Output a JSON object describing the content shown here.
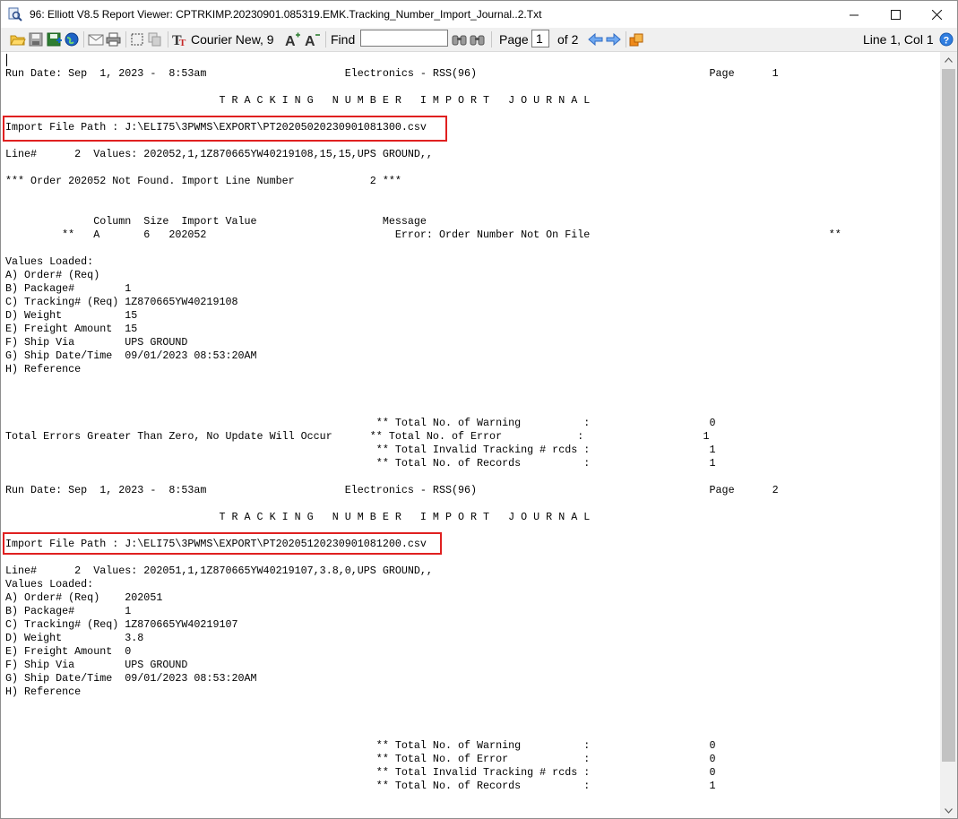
{
  "window": {
    "title": "96: Elliott V8.5 Report Viewer: CPTRKIMP.20230901.085319.EMK.Tracking_Number_Import_Journal..2.Txt",
    "minimize_icon": "minimize-icon",
    "maximize_icon": "maximize-icon",
    "close_icon": "close-icon"
  },
  "toolbar": {
    "icons": [
      "open-folder-icon",
      "save-icon",
      "save-as-icon",
      "globe-icon",
      "email-icon",
      "print-icon",
      "select-all-icon",
      "copy-icon",
      "font-icon",
      "increase-font-icon",
      "decrease-font-icon",
      "find-next-icon",
      "find-prev-icon",
      "prev-page-icon",
      "next-page-icon",
      "export-icon",
      "help-icon"
    ],
    "font_label": "Courier New, 9",
    "find_label": "Find",
    "find_value": "",
    "page_label": "Page",
    "page_value": "1",
    "page_of": "of 2",
    "position": "Line 1, Col 1"
  },
  "report": {
    "lines": [
      {
        "text": "Run Date: Sep  1, 2023 -  8:53am                      Electronics - RSS(96)                                     Page      1"
      },
      {
        "text": "                                  T R A C K I N G   N U M B E R   I M P O R T   J O U R N A L"
      },
      {
        "text": "Import File Path : J:\\ELI75\\3PWMS\\EXPORT\\PT20205020230901081300.csv"
      },
      {
        "text": "Line#      2  Values: 202052,1,1Z870665YW40219108,15,15,UPS GROUND,,"
      },
      {
        "text": "*** Order 202052 Not Found. Import Line Number            2 ***"
      },
      {
        "text": "              Column  Size  Import Value                    Message"
      },
      {
        "text": "         **   A       6   202052                              Error: Order Number Not On File                                      **"
      },
      {
        "text": "Values Loaded:"
      },
      {
        "text": "A) Order# (Req)"
      },
      {
        "text": "B) Package#        1"
      },
      {
        "text": "C) Tracking# (Req) 1Z870665YW40219108"
      },
      {
        "text": "D) Weight          15"
      },
      {
        "text": "E) Freight Amount  15"
      },
      {
        "text": "F) Ship Via        UPS GROUND"
      },
      {
        "text": "G) Ship Date/Time  09/01/2023 08:53:20AM"
      },
      {
        "text": "H) Reference"
      },
      {
        "text": "                                                           ** Total No. of Warning          :                   0"
      },
      {
        "text": "Total Errors Greater Than Zero, No Update Will Occur      ** Total No. of Error            :                   1"
      },
      {
        "text": "                                                           ** Total Invalid Tracking # rcds :                   1"
      },
      {
        "text": "                                                           ** Total No. of Records          :                   1"
      },
      {
        "text": "Run Date: Sep  1, 2023 -  8:53am                      Electronics - RSS(96)                                     Page      2"
      },
      {
        "text": "                                  T R A C K I N G   N U M B E R   I M P O R T   J O U R N A L"
      },
      {
        "text": "Import File Path : J:\\ELI75\\3PWMS\\EXPORT\\PT20205120230901081200.csv"
      },
      {
        "text": "Line#      2  Values: 202051,1,1Z870665YW40219107,3.8,0,UPS GROUND,,"
      },
      {
        "text": "Values Loaded:"
      },
      {
        "text": "A) Order# (Req)    202051"
      },
      {
        "text": "B) Package#        1"
      },
      {
        "text": "C) Tracking# (Req) 1Z870665YW40219107"
      },
      {
        "text": "D) Weight          3.8"
      },
      {
        "text": "E) Freight Amount  0"
      },
      {
        "text": "F) Ship Via        UPS GROUND"
      },
      {
        "text": "G) Ship Date/Time  09/01/2023 08:53:20AM"
      },
      {
        "text": "H) Reference"
      },
      {
        "text": "                                                           ** Total No. of Warning          :                   0"
      },
      {
        "text": "                                                           ** Total No. of Error            :                   0"
      },
      {
        "text": "                                                           ** Total Invalid Tracking # rcds :                   0"
      },
      {
        "text": "                                                           ** Total No. of Records          :                   1"
      }
    ],
    "highlight_color": "#e02020"
  },
  "scrollbar": {
    "up_icon": "scroll-up-arrow-icon",
    "down_icon": "scroll-down-arrow-icon"
  }
}
